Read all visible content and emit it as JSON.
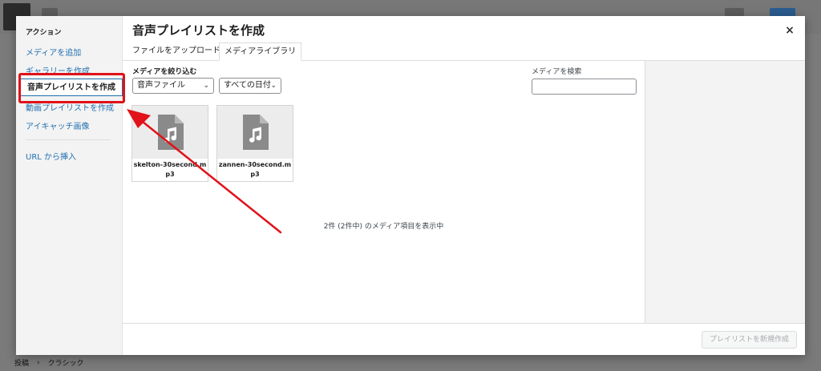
{
  "background": {
    "footer": {
      "crumb_1": "投稿",
      "separator": "›",
      "crumb_2": "クラシック"
    }
  },
  "modal": {
    "menu": {
      "heading": "アクション",
      "items": [
        {
          "label": "メディアを追加",
          "active": false
        },
        {
          "label": "ギャラリーを作成",
          "active": false
        },
        {
          "label": "音声プレイリストを作成",
          "active": true
        },
        {
          "label": "動画プレイリストを作成",
          "active": false
        },
        {
          "label": "アイキャッチ画像",
          "active": false
        }
      ],
      "insert_url": "URL から挿入"
    },
    "title": "音声プレイリストを作成",
    "close_label": "×",
    "tabs": [
      {
        "label": "ファイルをアップロード",
        "active": false
      },
      {
        "label": "メディアライブラリ",
        "active": true
      }
    ],
    "filter": {
      "label": "メディアを絞り込む",
      "type_select": "音声ファイル",
      "date_select": "すべての日付",
      "chevron": "⌄"
    },
    "search": {
      "label": "メディアを検索",
      "value": ""
    },
    "attachments": [
      {
        "filename": "skelton-30second.mp3",
        "icon": "audio-file-icon"
      },
      {
        "filename": "zannen-30second.mp3",
        "icon": "audio-file-icon"
      }
    ],
    "count_text": "2件 (2件中) のメディア項目を表示中",
    "create_button": "プレイリストを新規作成"
  },
  "colors": {
    "highlight": "#e1121a",
    "link": "#2271b1",
    "annotation_arrow": "#e1121a"
  }
}
